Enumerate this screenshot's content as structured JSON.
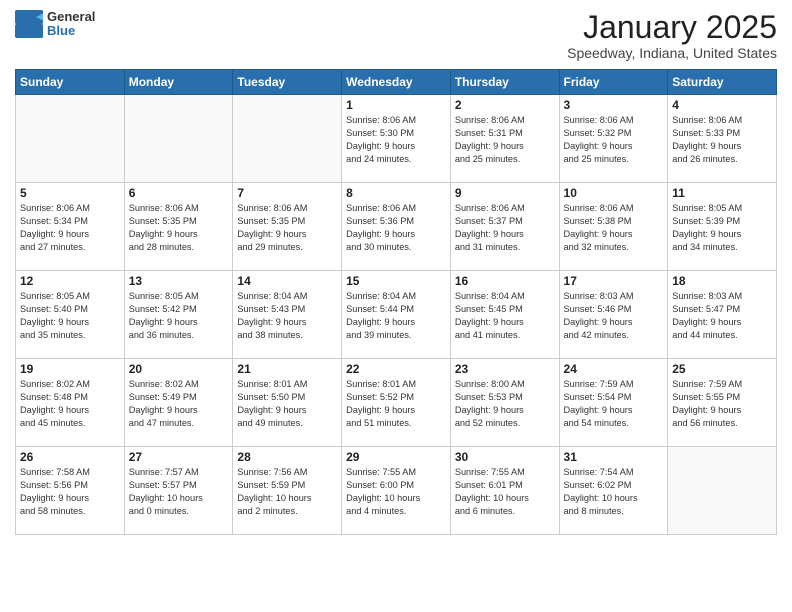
{
  "header": {
    "logo_general": "General",
    "logo_blue": "Blue",
    "month": "January 2025",
    "location": "Speedway, Indiana, United States"
  },
  "days_of_week": [
    "Sunday",
    "Monday",
    "Tuesday",
    "Wednesday",
    "Thursday",
    "Friday",
    "Saturday"
  ],
  "weeks": [
    [
      {
        "day": "",
        "info": ""
      },
      {
        "day": "",
        "info": ""
      },
      {
        "day": "",
        "info": ""
      },
      {
        "day": "1",
        "info": "Sunrise: 8:06 AM\nSunset: 5:30 PM\nDaylight: 9 hours\nand 24 minutes."
      },
      {
        "day": "2",
        "info": "Sunrise: 8:06 AM\nSunset: 5:31 PM\nDaylight: 9 hours\nand 25 minutes."
      },
      {
        "day": "3",
        "info": "Sunrise: 8:06 AM\nSunset: 5:32 PM\nDaylight: 9 hours\nand 25 minutes."
      },
      {
        "day": "4",
        "info": "Sunrise: 8:06 AM\nSunset: 5:33 PM\nDaylight: 9 hours\nand 26 minutes."
      }
    ],
    [
      {
        "day": "5",
        "info": "Sunrise: 8:06 AM\nSunset: 5:34 PM\nDaylight: 9 hours\nand 27 minutes."
      },
      {
        "day": "6",
        "info": "Sunrise: 8:06 AM\nSunset: 5:35 PM\nDaylight: 9 hours\nand 28 minutes."
      },
      {
        "day": "7",
        "info": "Sunrise: 8:06 AM\nSunset: 5:35 PM\nDaylight: 9 hours\nand 29 minutes."
      },
      {
        "day": "8",
        "info": "Sunrise: 8:06 AM\nSunset: 5:36 PM\nDaylight: 9 hours\nand 30 minutes."
      },
      {
        "day": "9",
        "info": "Sunrise: 8:06 AM\nSunset: 5:37 PM\nDaylight: 9 hours\nand 31 minutes."
      },
      {
        "day": "10",
        "info": "Sunrise: 8:06 AM\nSunset: 5:38 PM\nDaylight: 9 hours\nand 32 minutes."
      },
      {
        "day": "11",
        "info": "Sunrise: 8:05 AM\nSunset: 5:39 PM\nDaylight: 9 hours\nand 34 minutes."
      }
    ],
    [
      {
        "day": "12",
        "info": "Sunrise: 8:05 AM\nSunset: 5:40 PM\nDaylight: 9 hours\nand 35 minutes."
      },
      {
        "day": "13",
        "info": "Sunrise: 8:05 AM\nSunset: 5:42 PM\nDaylight: 9 hours\nand 36 minutes."
      },
      {
        "day": "14",
        "info": "Sunrise: 8:04 AM\nSunset: 5:43 PM\nDaylight: 9 hours\nand 38 minutes."
      },
      {
        "day": "15",
        "info": "Sunrise: 8:04 AM\nSunset: 5:44 PM\nDaylight: 9 hours\nand 39 minutes."
      },
      {
        "day": "16",
        "info": "Sunrise: 8:04 AM\nSunset: 5:45 PM\nDaylight: 9 hours\nand 41 minutes."
      },
      {
        "day": "17",
        "info": "Sunrise: 8:03 AM\nSunset: 5:46 PM\nDaylight: 9 hours\nand 42 minutes."
      },
      {
        "day": "18",
        "info": "Sunrise: 8:03 AM\nSunset: 5:47 PM\nDaylight: 9 hours\nand 44 minutes."
      }
    ],
    [
      {
        "day": "19",
        "info": "Sunrise: 8:02 AM\nSunset: 5:48 PM\nDaylight: 9 hours\nand 45 minutes."
      },
      {
        "day": "20",
        "info": "Sunrise: 8:02 AM\nSunset: 5:49 PM\nDaylight: 9 hours\nand 47 minutes."
      },
      {
        "day": "21",
        "info": "Sunrise: 8:01 AM\nSunset: 5:50 PM\nDaylight: 9 hours\nand 49 minutes."
      },
      {
        "day": "22",
        "info": "Sunrise: 8:01 AM\nSunset: 5:52 PM\nDaylight: 9 hours\nand 51 minutes."
      },
      {
        "day": "23",
        "info": "Sunrise: 8:00 AM\nSunset: 5:53 PM\nDaylight: 9 hours\nand 52 minutes."
      },
      {
        "day": "24",
        "info": "Sunrise: 7:59 AM\nSunset: 5:54 PM\nDaylight: 9 hours\nand 54 minutes."
      },
      {
        "day": "25",
        "info": "Sunrise: 7:59 AM\nSunset: 5:55 PM\nDaylight: 9 hours\nand 56 minutes."
      }
    ],
    [
      {
        "day": "26",
        "info": "Sunrise: 7:58 AM\nSunset: 5:56 PM\nDaylight: 9 hours\nand 58 minutes."
      },
      {
        "day": "27",
        "info": "Sunrise: 7:57 AM\nSunset: 5:57 PM\nDaylight: 10 hours\nand 0 minutes."
      },
      {
        "day": "28",
        "info": "Sunrise: 7:56 AM\nSunset: 5:59 PM\nDaylight: 10 hours\nand 2 minutes."
      },
      {
        "day": "29",
        "info": "Sunrise: 7:55 AM\nSunset: 6:00 PM\nDaylight: 10 hours\nand 4 minutes."
      },
      {
        "day": "30",
        "info": "Sunrise: 7:55 AM\nSunset: 6:01 PM\nDaylight: 10 hours\nand 6 minutes."
      },
      {
        "day": "31",
        "info": "Sunrise: 7:54 AM\nSunset: 6:02 PM\nDaylight: 10 hours\nand 8 minutes."
      },
      {
        "day": "",
        "info": ""
      }
    ]
  ]
}
